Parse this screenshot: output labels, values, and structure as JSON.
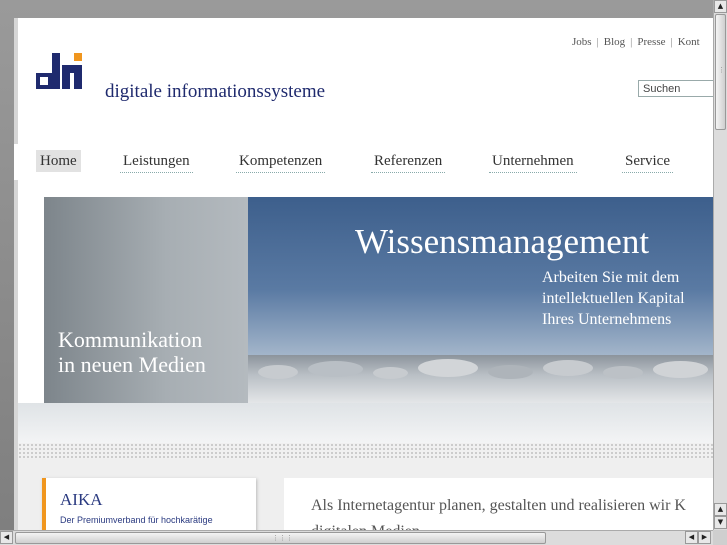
{
  "toplinks": [
    "Jobs",
    "Blog",
    "Presse",
    "Kont"
  ],
  "brand": {
    "name": "digitale informationssysteme",
    "logo_colors": {
      "navy": "#1f2a6e",
      "orange": "#f0961e"
    }
  },
  "search": {
    "placeholder": "Suchen"
  },
  "nav": {
    "items": [
      "Home",
      "Leistungen",
      "Kompetenzen",
      "Referenzen",
      "Unternehmen",
      "Service"
    ],
    "active": "Home"
  },
  "banner": {
    "headline": "Wissensmanagement",
    "subline": [
      "Arbeiten Sie mit dem",
      "intellektuellen Kapital",
      "Ihres Unternehmens"
    ],
    "left_text": [
      "Kommunikation",
      "in neuen Medien"
    ]
  },
  "aika": {
    "title": "AIKA",
    "text": "Der Premiumverband für hochkarätige"
  },
  "intro": {
    "lines": [
      "Als Internetagentur planen, gestalten und realisieren wir K",
      "digitalen Medien"
    ]
  },
  "colors": {
    "accent": "#f0961e",
    "brand_blue": "#2a3a80"
  }
}
